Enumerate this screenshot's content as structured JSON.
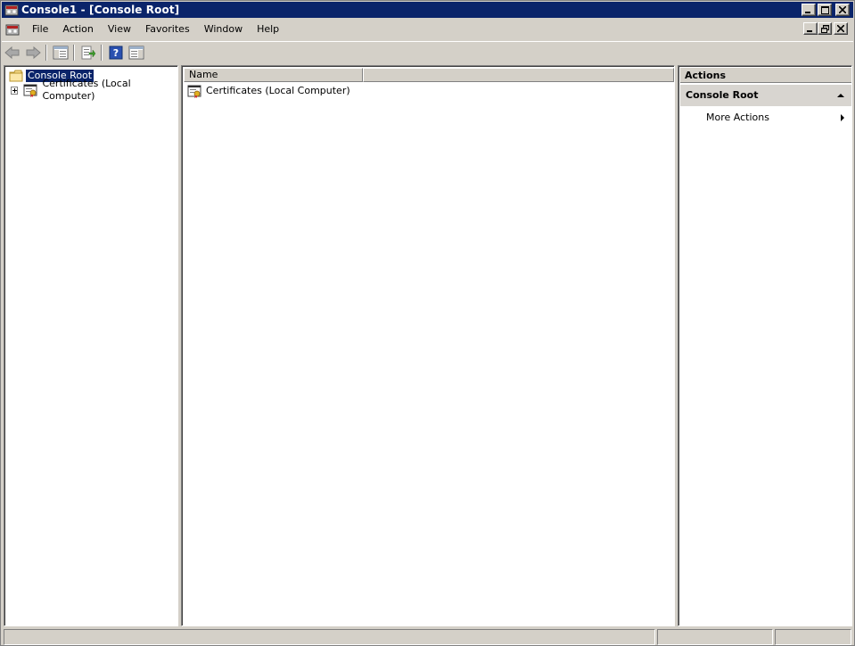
{
  "window": {
    "title": "Console1 - [Console Root]"
  },
  "menu": {
    "items": [
      "File",
      "Action",
      "View",
      "Favorites",
      "Window",
      "Help"
    ]
  },
  "tree": {
    "root_label": "Console Root",
    "child_label": "Certificates (Local Computer)"
  },
  "list": {
    "column_name": "Name",
    "rows": [
      "Certificates (Local Computer)"
    ]
  },
  "actions": {
    "title": "Actions",
    "section": "Console Root",
    "item": "More Actions"
  },
  "colors": {
    "title_bar": "#0a246a",
    "selection": "#0a246a",
    "chrome": "#d4d0c8"
  }
}
